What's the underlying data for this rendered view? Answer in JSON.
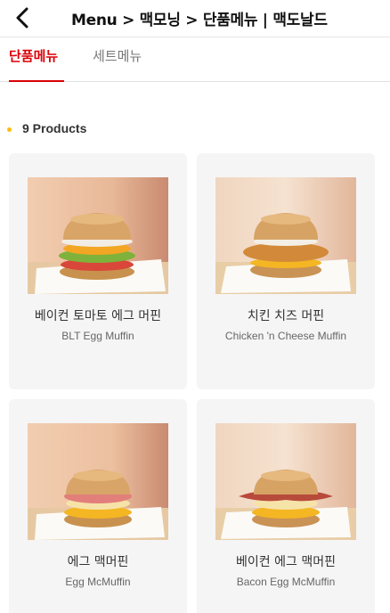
{
  "header": {
    "back_icon": "chevron-left-icon",
    "title": "Menu > 맥모닝 > 단품메뉴 | 맥도날드"
  },
  "tabs": [
    {
      "label": "단품메뉴",
      "active": true
    },
    {
      "label": "세트메뉴",
      "active": false
    }
  ],
  "products_count": "9 Products",
  "products": [
    {
      "name_ko": "베이컨 토마토 에그 머핀",
      "name_en": "BLT Egg Muffin"
    },
    {
      "name_ko": "치킨 치즈 머핀",
      "name_en": "Chicken 'n Cheese Muffin"
    },
    {
      "name_ko": "에그 맥머핀",
      "name_en": "Egg McMuffin"
    },
    {
      "name_ko": "베이컨 에그 맥머핀",
      "name_en": "Bacon Egg McMuffin"
    }
  ],
  "colors": {
    "accent_red": "#db0007",
    "dot_yellow": "#ffbc0d",
    "card_bg": "#f5f5f5"
  }
}
